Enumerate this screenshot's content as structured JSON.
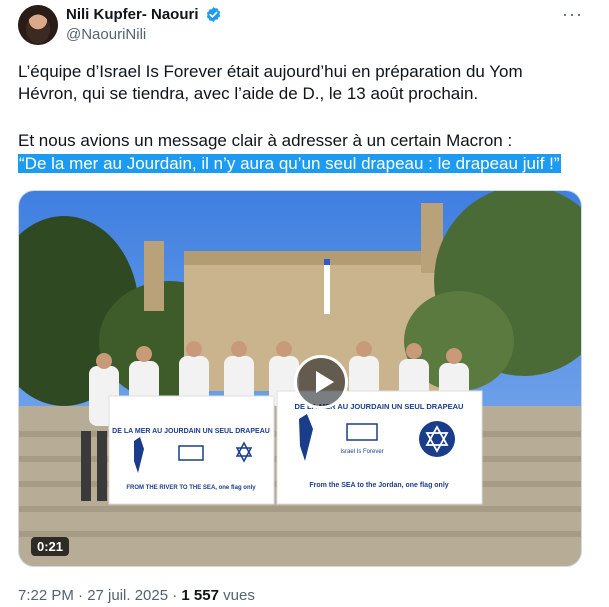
{
  "author": {
    "name": "Nili Kupfer- Naouri",
    "handle": "@NaouriNili",
    "verified": true
  },
  "more_icon": "···",
  "post": {
    "line1": "L’équipe d’Israel Is Forever était aujourd’hui en préparation du Yom",
    "line2": "Hévron, qui se tiendra, avec l’aide de D., le 13 août prochain.",
    "line3": "Et nous avions un message clair à adresser à un certain Macron :",
    "highlight": "“De la mer au Jourdain, il n’y aura qu’un seul drapeau : le drapeau juif !”"
  },
  "video": {
    "duration": "0:21",
    "banner_left_top": "DE LA MER AU JOURDAIN UN SEUL DRAPEAU",
    "banner_left_bottom": "FROM THE RIVER TO THE SEA, one flag only",
    "banner_right_top": "DE LA MER AU JOURDAIN UN SEUL DRAPEAU",
    "banner_right_bottom": "From the SEA to the Jordan, one flag only",
    "banner_logo_text": "Israel Is Forever"
  },
  "meta": {
    "time": "7:22 PM · 27 juil. 2025 · ",
    "views_count": "1 557",
    "views_label": " vues"
  },
  "colors": {
    "accent": "#1d9bf0",
    "text": "#0f1419",
    "secondary": "#536471"
  }
}
